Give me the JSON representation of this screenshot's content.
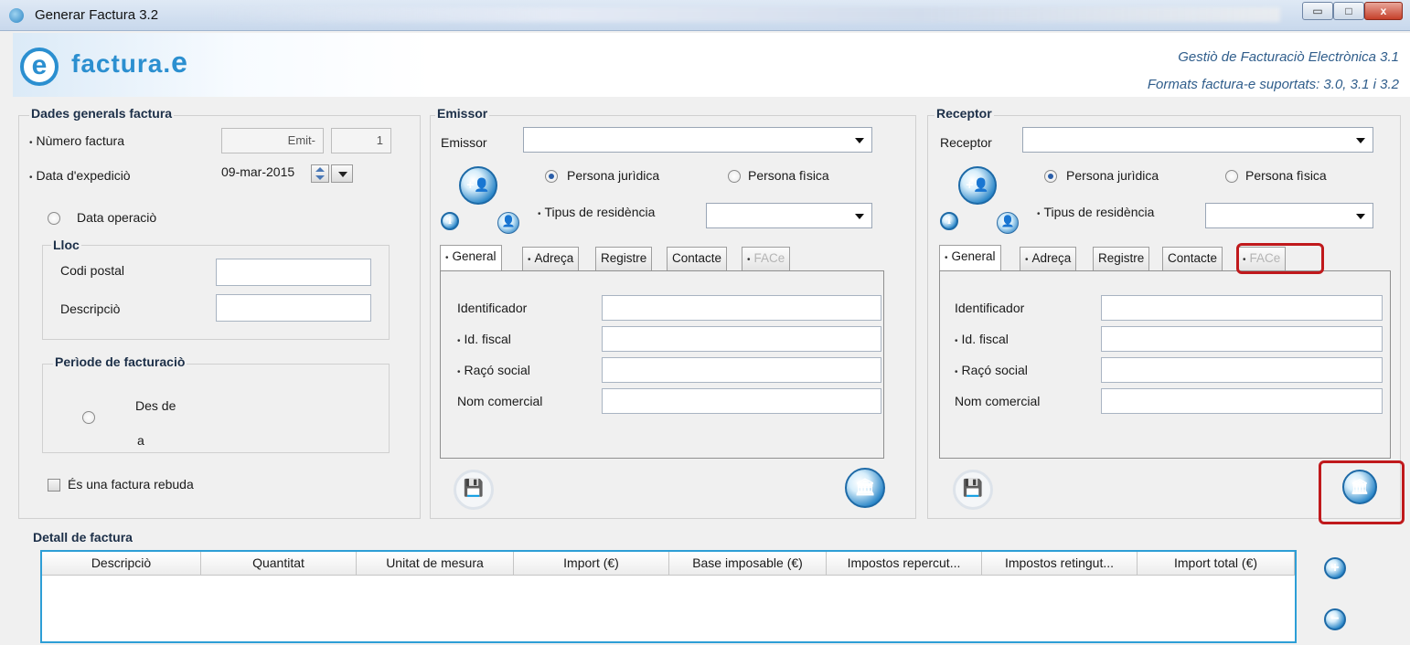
{
  "window": {
    "title": "Generar Factura 3.2",
    "controls": {
      "minimize": "▭",
      "maximize": "□",
      "close": "x"
    }
  },
  "header": {
    "logo_icon": "e",
    "logo_text": "factura.",
    "logo_suffix": "e",
    "subtitle1": "Gestiò de Facturaciò Electrònica 3.1",
    "subtitle2": "Formats factura-e suportats: 3.0, 3.1 i 3.2"
  },
  "dades": {
    "title": "Dades generals factura",
    "numero_label": "Nùmero factura",
    "numero_series": "Emit-",
    "numero_value": "1",
    "data_label": "Data d'expediciò",
    "data_value": "09-mar-2015",
    "data_operacio_label": "Data operaciò",
    "lloc_title": "Lloc",
    "codi_postal_label": "Codi postal",
    "descripcio_label": "Descripciò",
    "periode_title": "Perìode de facturaciò",
    "des_de_label": "Des de",
    "a_label": "a",
    "rebuda_label": "És una factura rebuda"
  },
  "emissor": {
    "title": "Emissor",
    "select_label": "Emissor",
    "persona_juridica": "Persona jurìdica",
    "persona_fisica": "Persona fìsica",
    "residencia_label": "Tipus de residència",
    "tabs": [
      "General",
      "Adreça",
      "Registre",
      "Contacte",
      "FACe"
    ],
    "fields": [
      "Identificador",
      "Id. fiscal",
      "Raçó social",
      "Nom comercial"
    ]
  },
  "receptor": {
    "title": "Receptor",
    "select_label": "Receptor",
    "persona_juridica": "Persona jurìdica",
    "persona_fisica": "Persona fìsica",
    "residencia_label": "Tipus de residència",
    "tabs": [
      "General",
      "Adreça",
      "Registre",
      "Contacte",
      "FACe"
    ],
    "fields": [
      "Identificador",
      "Id. fiscal",
      "Raçó social",
      "Nom comercial"
    ]
  },
  "detall": {
    "title": "Detall de factura",
    "columns": [
      "Descripciò",
      "Quantitat",
      "Unitat de mesura",
      "Import (€)",
      "Base imposable (€)",
      "Impostos repercut...",
      "Impostos retingut...",
      "Import total (€)"
    ],
    "add_icon": "+",
    "remove_icon": "−"
  },
  "icons": {
    "add_person": "+👤",
    "info_small": "ℹ",
    "bank": "🏛",
    "save": "💾",
    "red_person": "👤"
  },
  "colors": {
    "accent": "#2b8fd0",
    "highlight": "#c0191c",
    "table_border": "#2d9ed6"
  }
}
